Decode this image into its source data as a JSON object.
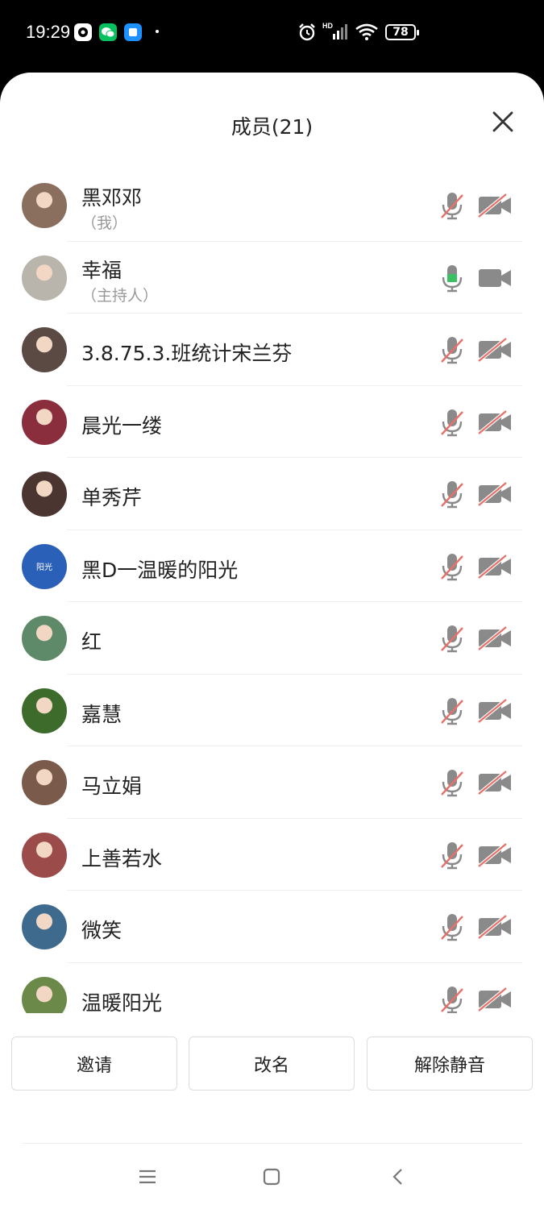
{
  "status_bar": {
    "time": "19:29",
    "battery": "78"
  },
  "panel": {
    "title": "成员(21)"
  },
  "members": [
    {
      "name": "黑邓邓",
      "role": "（我）",
      "mic": "muted",
      "cam": "off"
    },
    {
      "name": "幸福",
      "role": "（主持人）",
      "mic": "on",
      "cam": "on"
    },
    {
      "name": "3.8.75.3.班统计宋兰芬",
      "role": "",
      "mic": "muted",
      "cam": "off"
    },
    {
      "name": "晨光一缕",
      "role": "",
      "mic": "muted",
      "cam": "off"
    },
    {
      "name": "单秀芹",
      "role": "",
      "mic": "muted",
      "cam": "off"
    },
    {
      "name": "黑D一温暖的阳光",
      "role": "",
      "mic": "muted",
      "cam": "off",
      "avatar_text": "阳光"
    },
    {
      "name": "红",
      "role": "",
      "mic": "muted",
      "cam": "off"
    },
    {
      "name": "嘉慧",
      "role": "",
      "mic": "muted",
      "cam": "off"
    },
    {
      "name": "马立娟",
      "role": "",
      "mic": "muted",
      "cam": "off"
    },
    {
      "name": "上善若水",
      "role": "",
      "mic": "muted",
      "cam": "off"
    },
    {
      "name": "微笑",
      "role": "",
      "mic": "muted",
      "cam": "off"
    },
    {
      "name": "温暖阳光",
      "role": "",
      "mic": "muted",
      "cam": "off"
    }
  ],
  "actions": {
    "invite": "邀请",
    "rename": "改名",
    "unmute_all": "解除静音"
  },
  "colors": {
    "accent_green": "#3cc064",
    "muted_red": "#e8706a",
    "icon_gray": "#8a8a8a",
    "avatar_blue": "#2b60b8"
  }
}
